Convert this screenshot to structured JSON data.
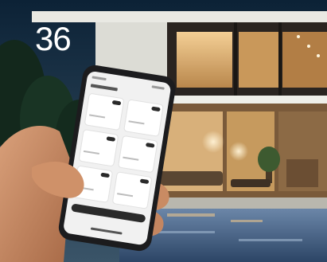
{
  "page_number": "36",
  "scene": {
    "description_icons": [
      "house-photo",
      "smartphone-in-hand",
      "smart-home-app-screen"
    ]
  },
  "colors": {
    "sky_top": "#0c2236",
    "sky_bottom": "#3a5468",
    "wall_white": "#e9e9e3",
    "window_glow": "#e8b574",
    "interior_warm": "#c9985a",
    "pool": "#3f5f8a",
    "phone_body": "#1c1c1e",
    "screen": "#f1f1f1",
    "skin": "#c98b63"
  }
}
